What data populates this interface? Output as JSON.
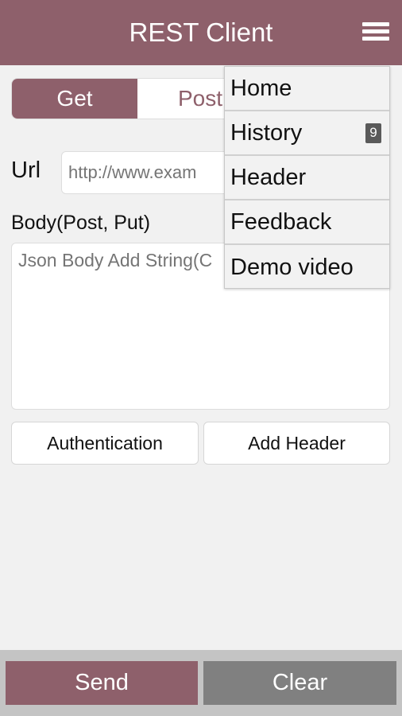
{
  "header": {
    "title": "REST Client",
    "menu_icon": "hamburger-icon"
  },
  "methods": {
    "get": "Get",
    "post": "Post",
    "selected": "Get"
  },
  "url": {
    "label": "Url",
    "placeholder": "http://www.exam"
  },
  "body": {
    "label": "Body(Post, Put)",
    "placeholder": "Json Body Add String(C"
  },
  "buttons": {
    "authentication": "Authentication",
    "add_header": "Add Header",
    "send": "Send",
    "clear": "Clear"
  },
  "menu": {
    "items": [
      {
        "label": "Home"
      },
      {
        "label": "History",
        "badge": "9"
      },
      {
        "label": "Header"
      },
      {
        "label": "Feedback"
      },
      {
        "label": "Demo video"
      }
    ]
  },
  "colors": {
    "accent": "#8e606b",
    "clear": "#808080"
  }
}
